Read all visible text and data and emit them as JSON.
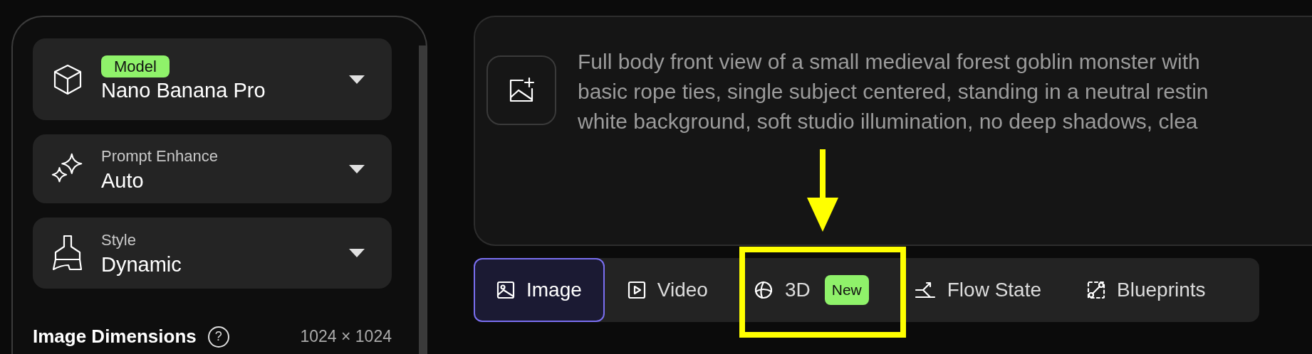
{
  "settings": [
    {
      "kind": "badge",
      "label": "Model",
      "value": "Nano Banana Pro"
    },
    {
      "kind": "plain",
      "label": "Prompt Enhance",
      "value": "Auto"
    },
    {
      "kind": "plain",
      "label": "Style",
      "value": "Dynamic"
    }
  ],
  "dimensions": {
    "label": "Image Dimensions",
    "help": "?",
    "value": "1024 × 1024"
  },
  "prompt_lines": [
    "Full body front view of a small medieval forest goblin monster with",
    "basic rope ties, single subject centered, standing in a neutral restin",
    "white background, soft studio illumination, no deep shadows, clea"
  ],
  "tabs": [
    {
      "label": "Image",
      "selected": true
    },
    {
      "label": "Video",
      "selected": false
    },
    {
      "label": "3D",
      "selected": false,
      "badge": "New"
    },
    {
      "label": "Flow State",
      "selected": false
    },
    {
      "label": "Blueprints",
      "selected": false
    }
  ],
  "annotations": [
    {
      "kind": "arrow"
    },
    {
      "kind": "box"
    }
  ]
}
